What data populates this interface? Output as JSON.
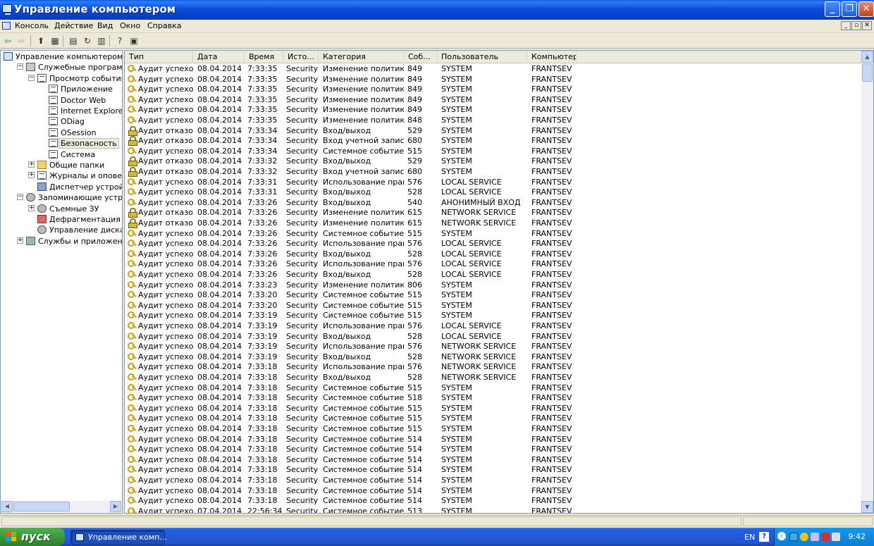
{
  "window": {
    "title": "Управление компьютером"
  },
  "menu": [
    "Консоль",
    "Действие",
    "Вид",
    "Окно",
    "Справка"
  ],
  "mdi_buttons": [
    "_",
    "▫",
    "✕"
  ],
  "toolbar_icons": [
    "back-icon",
    "forward-icon",
    "up-icon",
    "show-tree-icon",
    "properties-icon",
    "refresh-icon",
    "export-icon",
    "help-icon",
    "mmc-view-icon"
  ],
  "tree": [
    {
      "label": "Управление компьютером (локальным)",
      "level": 0,
      "icon": "computer",
      "expander": ""
    },
    {
      "label": "Служебные программы",
      "level": 1,
      "icon": "tools",
      "expander": "−"
    },
    {
      "label": "Просмотр событий",
      "level": 2,
      "icon": "log",
      "expander": "−"
    },
    {
      "label": "Приложение",
      "level": 3,
      "icon": "log",
      "expander": ""
    },
    {
      "label": "Doctor Web",
      "level": 3,
      "icon": "log",
      "expander": ""
    },
    {
      "label": "Internet Explorer",
      "level": 3,
      "icon": "log",
      "expander": ""
    },
    {
      "label": "ODiag",
      "level": 3,
      "icon": "log",
      "expander": ""
    },
    {
      "label": "OSession",
      "level": 3,
      "icon": "log",
      "expander": ""
    },
    {
      "label": "Безопасность",
      "level": 3,
      "icon": "log",
      "expander": "",
      "selected": true
    },
    {
      "label": "Система",
      "level": 3,
      "icon": "log",
      "expander": ""
    },
    {
      "label": "Общие папки",
      "level": 2,
      "icon": "folder",
      "expander": "+"
    },
    {
      "label": "Журналы и оповещения производительности",
      "level": 2,
      "icon": "log",
      "expander": "+"
    },
    {
      "label": "Диспетчер устройств",
      "level": 2,
      "icon": "device",
      "expander": ""
    },
    {
      "label": "Запоминающие устройства",
      "level": 1,
      "icon": "disk",
      "expander": "−"
    },
    {
      "label": "Съемные ЗУ",
      "level": 2,
      "icon": "disk",
      "expander": "+"
    },
    {
      "label": "Дефрагментация диска",
      "level": 2,
      "icon": "defrag",
      "expander": ""
    },
    {
      "label": "Управление дисками",
      "level": 2,
      "icon": "disk",
      "expander": ""
    },
    {
      "label": "Службы и приложения",
      "level": 1,
      "icon": "services",
      "expander": "+"
    }
  ],
  "columns": [
    "Тип",
    "Дата",
    "Время",
    "Исто...",
    "Категория",
    "Соб...",
    "Пользователь",
    "Компьютер"
  ],
  "events": [
    [
      "s",
      "Аудит успехов",
      "08.04.2014",
      "7:33:35",
      "Security",
      "Изменение политики",
      "849",
      "SYSTEM",
      "FRANTSEV"
    ],
    [
      "s",
      "Аудит успехов",
      "08.04.2014",
      "7:33:35",
      "Security",
      "Изменение политики",
      "849",
      "SYSTEM",
      "FRANTSEV"
    ],
    [
      "s",
      "Аудит успехов",
      "08.04.2014",
      "7:33:35",
      "Security",
      "Изменение политики",
      "849",
      "SYSTEM",
      "FRANTSEV"
    ],
    [
      "s",
      "Аудит успехов",
      "08.04.2014",
      "7:33:35",
      "Security",
      "Изменение политики",
      "849",
      "SYSTEM",
      "FRANTSEV"
    ],
    [
      "s",
      "Аудит успехов",
      "08.04.2014",
      "7:33:35",
      "Security",
      "Изменение политики",
      "849",
      "SYSTEM",
      "FRANTSEV"
    ],
    [
      "s",
      "Аудит успехов",
      "08.04.2014",
      "7:33:35",
      "Security",
      "Изменение политики",
      "848",
      "SYSTEM",
      "FRANTSEV"
    ],
    [
      "f",
      "Аудит отказов",
      "08.04.2014",
      "7:33:34",
      "Security",
      "Вход/выход",
      "529",
      "SYSTEM",
      "FRANTSEV"
    ],
    [
      "f",
      "Аудит отказов",
      "08.04.2014",
      "7:33:34",
      "Security",
      "Вход учетной записи",
      "680",
      "SYSTEM",
      "FRANTSEV"
    ],
    [
      "s",
      "Аудит успехов",
      "08.04.2014",
      "7:33:34",
      "Security",
      "Системное событие",
      "515",
      "SYSTEM",
      "FRANTSEV"
    ],
    [
      "f",
      "Аудит отказов",
      "08.04.2014",
      "7:33:32",
      "Security",
      "Вход/выход",
      "529",
      "SYSTEM",
      "FRANTSEV"
    ],
    [
      "f",
      "Аудит отказов",
      "08.04.2014",
      "7:33:32",
      "Security",
      "Вход учетной записи",
      "680",
      "SYSTEM",
      "FRANTSEV"
    ],
    [
      "s",
      "Аудит успехов",
      "08.04.2014",
      "7:33:31",
      "Security",
      "Использование прав",
      "576",
      "LOCAL SERVICE",
      "FRANTSEV"
    ],
    [
      "s",
      "Аудит успехов",
      "08.04.2014",
      "7:33:31",
      "Security",
      "Вход/выход",
      "528",
      "LOCAL SERVICE",
      "FRANTSEV"
    ],
    [
      "s",
      "Аудит успехов",
      "08.04.2014",
      "7:33:26",
      "Security",
      "Вход/выход",
      "540",
      "АНОНИМНЫЙ ВХОД",
      "FRANTSEV"
    ],
    [
      "f",
      "Аудит отказов",
      "08.04.2014",
      "7:33:26",
      "Security",
      "Изменение политики",
      "615",
      "NETWORK SERVICE",
      "FRANTSEV"
    ],
    [
      "f",
      "Аудит отказов",
      "08.04.2014",
      "7:33:26",
      "Security",
      "Изменение политики",
      "615",
      "NETWORK SERVICE",
      "FRANTSEV"
    ],
    [
      "s",
      "Аудит успехов",
      "08.04.2014",
      "7:33:26",
      "Security",
      "Системное событие",
      "515",
      "SYSTEM",
      "FRANTSEV"
    ],
    [
      "s",
      "Аудит успехов",
      "08.04.2014",
      "7:33:26",
      "Security",
      "Использование прав",
      "576",
      "LOCAL SERVICE",
      "FRANTSEV"
    ],
    [
      "s",
      "Аудит успехов",
      "08.04.2014",
      "7:33:26",
      "Security",
      "Вход/выход",
      "528",
      "LOCAL SERVICE",
      "FRANTSEV"
    ],
    [
      "s",
      "Аудит успехов",
      "08.04.2014",
      "7:33:26",
      "Security",
      "Использование прав",
      "576",
      "LOCAL SERVICE",
      "FRANTSEV"
    ],
    [
      "s",
      "Аудит успехов",
      "08.04.2014",
      "7:33:26",
      "Security",
      "Вход/выход",
      "528",
      "LOCAL SERVICE",
      "FRANTSEV"
    ],
    [
      "s",
      "Аудит успехов",
      "08.04.2014",
      "7:33:23",
      "Security",
      "Изменение политики",
      "806",
      "SYSTEM",
      "FRANTSEV"
    ],
    [
      "s",
      "Аудит успехов",
      "08.04.2014",
      "7:33:20",
      "Security",
      "Системное событие",
      "515",
      "SYSTEM",
      "FRANTSEV"
    ],
    [
      "s",
      "Аудит успехов",
      "08.04.2014",
      "7:33:20",
      "Security",
      "Системное событие",
      "515",
      "SYSTEM",
      "FRANTSEV"
    ],
    [
      "s",
      "Аудит успехов",
      "08.04.2014",
      "7:33:19",
      "Security",
      "Системное событие",
      "515",
      "SYSTEM",
      "FRANTSEV"
    ],
    [
      "s",
      "Аудит успехов",
      "08.04.2014",
      "7:33:19",
      "Security",
      "Использование прав",
      "576",
      "LOCAL SERVICE",
      "FRANTSEV"
    ],
    [
      "s",
      "Аудит успехов",
      "08.04.2014",
      "7:33:19",
      "Security",
      "Вход/выход",
      "528",
      "LOCAL SERVICE",
      "FRANTSEV"
    ],
    [
      "s",
      "Аудит успехов",
      "08.04.2014",
      "7:33:19",
      "Security",
      "Использование прав",
      "576",
      "NETWORK SERVICE",
      "FRANTSEV"
    ],
    [
      "s",
      "Аудит успехов",
      "08.04.2014",
      "7:33:19",
      "Security",
      "Вход/выход",
      "528",
      "NETWORK SERVICE",
      "FRANTSEV"
    ],
    [
      "s",
      "Аудит успехов",
      "08.04.2014",
      "7:33:18",
      "Security",
      "Использование прав",
      "576",
      "NETWORK SERVICE",
      "FRANTSEV"
    ],
    [
      "s",
      "Аудит успехов",
      "08.04.2014",
      "7:33:18",
      "Security",
      "Вход/выход",
      "528",
      "NETWORK SERVICE",
      "FRANTSEV"
    ],
    [
      "s",
      "Аудит успехов",
      "08.04.2014",
      "7:33:18",
      "Security",
      "Системное событие",
      "515",
      "SYSTEM",
      "FRANTSEV"
    ],
    [
      "s",
      "Аудит успехов",
      "08.04.2014",
      "7:33:18",
      "Security",
      "Системное событие",
      "518",
      "SYSTEM",
      "FRANTSEV"
    ],
    [
      "s",
      "Аудит успехов",
      "08.04.2014",
      "7:33:18",
      "Security",
      "Системное событие",
      "515",
      "SYSTEM",
      "FRANTSEV"
    ],
    [
      "s",
      "Аудит успехов",
      "08.04.2014",
      "7:33:18",
      "Security",
      "Системное событие",
      "515",
      "SYSTEM",
      "FRANTSEV"
    ],
    [
      "s",
      "Аудит успехов",
      "08.04.2014",
      "7:33:18",
      "Security",
      "Системное событие",
      "515",
      "SYSTEM",
      "FRANTSEV"
    ],
    [
      "s",
      "Аудит успехов",
      "08.04.2014",
      "7:33:18",
      "Security",
      "Системное событие",
      "514",
      "SYSTEM",
      "FRANTSEV"
    ],
    [
      "s",
      "Аудит успехов",
      "08.04.2014",
      "7:33:18",
      "Security",
      "Системное событие",
      "514",
      "SYSTEM",
      "FRANTSEV"
    ],
    [
      "s",
      "Аудит успехов",
      "08.04.2014",
      "7:33:18",
      "Security",
      "Системное событие",
      "514",
      "SYSTEM",
      "FRANTSEV"
    ],
    [
      "s",
      "Аудит успехов",
      "08.04.2014",
      "7:33:18",
      "Security",
      "Системное событие",
      "514",
      "SYSTEM",
      "FRANTSEV"
    ],
    [
      "s",
      "Аудит успехов",
      "08.04.2014",
      "7:33:18",
      "Security",
      "Системное событие",
      "514",
      "SYSTEM",
      "FRANTSEV"
    ],
    [
      "s",
      "Аудит успехов",
      "08.04.2014",
      "7:33:18",
      "Security",
      "Системное событие",
      "514",
      "SYSTEM",
      "FRANTSEV"
    ],
    [
      "s",
      "Аудит успехов",
      "08.04.2014",
      "7:33:18",
      "Security",
      "Системное событие",
      "514",
      "SYSTEM",
      "FRANTSEV"
    ],
    [
      "s",
      "Аудит успехов",
      "07.04.2014",
      "22:56:34",
      "Security",
      "Системное событие",
      "513",
      "SYSTEM",
      "FRANTSEV"
    ]
  ],
  "taskbar": {
    "start_label": "пуск",
    "task_item": "Управление комп...",
    "language": "EN",
    "help": "?",
    "clock": "9:42"
  },
  "colors": {
    "title_blue": "#0b4ddb",
    "start_green": "#3c9a3c",
    "tray_blue": "#0b7fd6",
    "face": "#ece9d8"
  }
}
